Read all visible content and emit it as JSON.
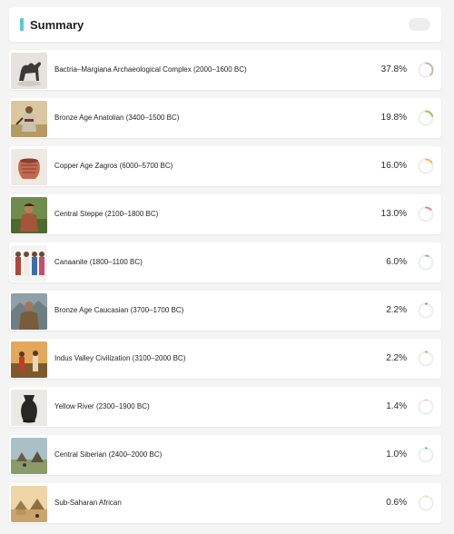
{
  "header": {
    "title": "Summary",
    "accent_color": "#5bc8d0",
    "toggle_color": "#ededed"
  },
  "rows": [
    {
      "name": "Bactria–Margiana Archaeological Complex (2000–1600 BC)",
      "percent": "37.8%",
      "value": 37.8,
      "color": "#c7b9a8",
      "thumb": "camel-figurine"
    },
    {
      "name": "Bronze Age Anatolian (3400–1500 BC)",
      "percent": "19.8%",
      "value": 19.8,
      "color": "#9cc14f",
      "thumb": "anatolian-figure"
    },
    {
      "name": "Copper Age Zagros (6000–5700 BC)",
      "percent": "16.0%",
      "value": 16.0,
      "color": "#f5b65a",
      "thumb": "clay-pot"
    },
    {
      "name": "Central Steppe (2100–1800 BC)",
      "percent": "13.0%",
      "value": 13.0,
      "color": "#f07aa3",
      "thumb": "steppe-person"
    },
    {
      "name": "Canaanite (1800–1100 BC)",
      "percent": "6.0%",
      "value": 6.0,
      "color": "#7cc7a0",
      "thumb": "canaanite-group"
    },
    {
      "name": "Bronze Age Caucasian (3700–1700 BC)",
      "percent": "2.2%",
      "value": 2.2,
      "color": "#8c8f99",
      "thumb": "caucasian-man"
    },
    {
      "name": "Indus Valley Civilization (3100–2000 BC)",
      "percent": "2.2%",
      "value": 2.2,
      "color": "#8ac24a",
      "thumb": "indus-people"
    },
    {
      "name": "Yellow River (2300–1900 BC)",
      "percent": "1.4%",
      "value": 1.4,
      "color": "#f6c08a",
      "thumb": "black-vessel"
    },
    {
      "name": "Central Siberian (2400–2000 BC)",
      "percent": "1.0%",
      "value": 1.0,
      "color": "#5b9bd5",
      "thumb": "siberian-camp"
    },
    {
      "name": "Sub-Saharan African",
      "percent": "0.6%",
      "value": 0.6,
      "color": "#f3cf91",
      "thumb": "african-village"
    }
  ]
}
